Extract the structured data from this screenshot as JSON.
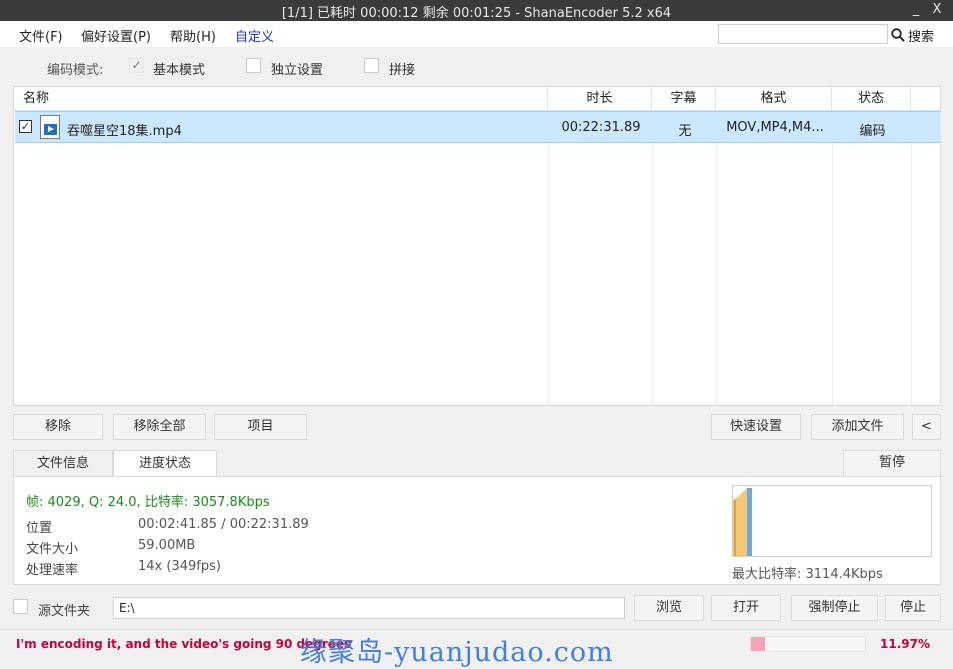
{
  "window": {
    "title": "[1/1] 已耗时 00:00:12  剩余 00:01:25 - ShanaEncoder 5.2 x64",
    "minimize": "_",
    "close": "X"
  },
  "menu": {
    "file": "文件(F)",
    "prefs": "偏好设置(P)",
    "help": "帮助(H)",
    "custom": "自定义",
    "search_placeholder": "",
    "search_label": "搜索"
  },
  "mode": {
    "label": "编码模式:",
    "options": [
      {
        "label": "基本模式",
        "checked": true
      },
      {
        "label": "独立设置",
        "checked": false
      },
      {
        "label": "拼接",
        "checked": false
      }
    ]
  },
  "table": {
    "columns": [
      "名称",
      "时长",
      "字幕",
      "格式",
      "状态"
    ],
    "rows": [
      {
        "checked": true,
        "name": "吞噬星空18集.mp4",
        "duration": "00:22:31.89",
        "subtitle": "无",
        "format": "MOV,MP4,M4...",
        "status": "编码"
      }
    ]
  },
  "buttons": {
    "remove": "移除",
    "remove_all": "移除全部",
    "item": "项目",
    "quick_settings": "快速设置",
    "add_file": "添加文件",
    "collapse": "<"
  },
  "tabs": {
    "file_info": "文件信息",
    "progress": "进度状态",
    "pause": "暂停"
  },
  "progress_panel": {
    "stats_line": "帧: 4029, Q: 24.0, 比特率: 3057.8Kbps",
    "position_label": "位置",
    "position_value": "00:02:41.85 / 00:22:31.89",
    "size_label": "文件大小",
    "size_value": "59.00MB",
    "speed_label": "处理速率",
    "speed_value": "14x (349fps)",
    "max_bitrate": "最大比特率: 3114.4Kbps",
    "stats_color": "#1a8a1a"
  },
  "source": {
    "checkbox_label": "源文件夹",
    "path": "E:\\",
    "browse": "浏览",
    "open": "打开",
    "force_stop": "强制停止",
    "stop": "停止"
  },
  "status": {
    "message": "I'm encoding it, and the video's going 90 degrees",
    "watermark": "缘聚岛-yuanjudao.com",
    "progress": 0.1197,
    "percent_text": "11.97%"
  }
}
